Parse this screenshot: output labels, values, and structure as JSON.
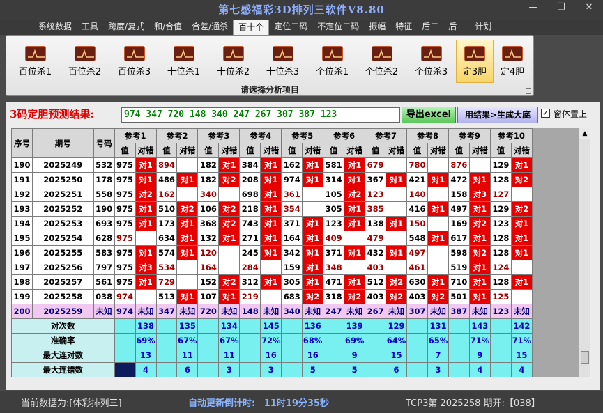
{
  "window": {
    "title": "第七感福彩3D排列三软件V8.80",
    "buttons": [
      "—",
      "❐",
      "✕"
    ]
  },
  "menu": [
    "系统数据",
    "工具",
    "跨度/复式",
    "和/合值",
    "合差/通杀",
    "百十个",
    "定位二码",
    "不定位二码",
    "振幅",
    "特征",
    "后二",
    "后一",
    "计划"
  ],
  "menu_active": "百十个",
  "ribbon": {
    "tools": [
      "百位杀1",
      "百位杀2",
      "百位杀3",
      "十位杀1",
      "十位杀2",
      "十位杀3",
      "个位杀1",
      "个位杀2",
      "个位杀3",
      "定3胆",
      "定4胆"
    ],
    "selected": "定3胆",
    "caption": "请选择分析项目"
  },
  "result": {
    "label": "3码定胆预测结果:",
    "value": "974 347 720 148 340 247 267 307 387 123",
    "excel_button": "导出excel",
    "gen_button": "用结果>生成大底",
    "topmost_checked": "✓",
    "topmost_label": "窗体置上"
  },
  "grid": {
    "headers": {
      "seq": "序号",
      "period": "期号",
      "number": "号码",
      "val": "值",
      "check": "对错"
    },
    "refs": [
      "参考1",
      "参考2",
      "参考3",
      "参考4",
      "参考5",
      "参考6",
      "参考7",
      "参考8",
      "参考9",
      "参考10"
    ],
    "rows": [
      {
        "seq": "190",
        "period": "2025249",
        "number": "532",
        "cells": [
          [
            "975",
            "对1"
          ],
          [
            "894",
            ""
          ],
          [
            "182",
            "对1"
          ],
          [
            "384",
            "对1"
          ],
          [
            "162",
            "对1"
          ],
          [
            "581",
            "对1"
          ],
          [
            "679",
            ""
          ],
          [
            "780",
            ""
          ],
          [
            "876",
            ""
          ],
          [
            "129",
            "对1"
          ]
        ]
      },
      {
        "seq": "191",
        "period": "2025250",
        "number": "178",
        "cells": [
          [
            "975",
            "对1"
          ],
          [
            "486",
            "对1"
          ],
          [
            "182",
            "对2"
          ],
          [
            "208",
            "对1"
          ],
          [
            "974",
            "对1"
          ],
          [
            "314",
            "对1"
          ],
          [
            "367",
            "对1"
          ],
          [
            "421",
            "对1"
          ],
          [
            "472",
            "对1"
          ],
          [
            "128",
            "对2"
          ]
        ]
      },
      {
        "seq": "192",
        "period": "2025251",
        "number": "558",
        "cells": [
          [
            "975",
            "对2"
          ],
          [
            "162",
            ""
          ],
          [
            "340",
            ""
          ],
          [
            "698",
            "对1"
          ],
          [
            "361",
            ""
          ],
          [
            "105",
            "对2"
          ],
          [
            "123",
            ""
          ],
          [
            "140",
            ""
          ],
          [
            "158",
            "对3"
          ],
          [
            "127",
            ""
          ]
        ]
      },
      {
        "seq": "193",
        "period": "2025252",
        "number": "190",
        "cells": [
          [
            "975",
            "对1"
          ],
          [
            "510",
            "对2"
          ],
          [
            "106",
            "对2"
          ],
          [
            "218",
            "对1"
          ],
          [
            "354",
            ""
          ],
          [
            "305",
            "对1"
          ],
          [
            "385",
            ""
          ],
          [
            "416",
            "对1"
          ],
          [
            "497",
            "对1"
          ],
          [
            "129",
            "对2"
          ]
        ]
      },
      {
        "seq": "194",
        "period": "2025253",
        "number": "693",
        "cells": [
          [
            "975",
            "对1"
          ],
          [
            "173",
            "对1"
          ],
          [
            "368",
            "对2"
          ],
          [
            "743",
            "对1"
          ],
          [
            "371",
            "对1"
          ],
          [
            "123",
            "对1"
          ],
          [
            "138",
            "对1"
          ],
          [
            "150",
            ""
          ],
          [
            "169",
            "对2"
          ],
          [
            "123",
            "对1"
          ]
        ]
      },
      {
        "seq": "195",
        "period": "2025254",
        "number": "628",
        "cells": [
          [
            "975",
            ""
          ],
          [
            "634",
            "对1"
          ],
          [
            "132",
            "对1"
          ],
          [
            "271",
            "对1"
          ],
          [
            "164",
            "对1"
          ],
          [
            "409",
            ""
          ],
          [
            "479",
            ""
          ],
          [
            "548",
            "对1"
          ],
          [
            "617",
            "对1"
          ],
          [
            "128",
            "对1"
          ]
        ]
      },
      {
        "seq": "196",
        "period": "2025255",
        "number": "583",
        "cells": [
          [
            "975",
            "对1"
          ],
          [
            "574",
            "对1"
          ],
          [
            "120",
            ""
          ],
          [
            "245",
            "对1"
          ],
          [
            "342",
            "对1"
          ],
          [
            "371",
            "对1"
          ],
          [
            "432",
            "对1"
          ],
          [
            "497",
            ""
          ],
          [
            "598",
            "对2"
          ],
          [
            "128",
            "对1"
          ]
        ]
      },
      {
        "seq": "197",
        "period": "2025256",
        "number": "797",
        "cells": [
          [
            "975",
            "对3"
          ],
          [
            "534",
            ""
          ],
          [
            "164",
            ""
          ],
          [
            "284",
            ""
          ],
          [
            "159",
            "对1"
          ],
          [
            "348",
            ""
          ],
          [
            "403",
            ""
          ],
          [
            "461",
            ""
          ],
          [
            "519",
            "对1"
          ],
          [
            "124",
            ""
          ]
        ]
      },
      {
        "seq": "198",
        "period": "2025257",
        "number": "561",
        "cells": [
          [
            "975",
            "对1"
          ],
          [
            "729",
            ""
          ],
          [
            "152",
            "对2"
          ],
          [
            "312",
            "对1"
          ],
          [
            "305",
            "对1"
          ],
          [
            "471",
            "对1"
          ],
          [
            "512",
            "对2"
          ],
          [
            "630",
            "对1"
          ],
          [
            "710",
            "对1"
          ],
          [
            "128",
            "对1"
          ]
        ]
      },
      {
        "seq": "199",
        "period": "2025258",
        "number": "038",
        "cells": [
          [
            "974",
            ""
          ],
          [
            "513",
            "对1"
          ],
          [
            "107",
            "对1"
          ],
          [
            "219",
            ""
          ],
          [
            "683",
            "对2"
          ],
          [
            "318",
            "对2"
          ],
          [
            "403",
            "对2"
          ],
          [
            "403",
            "对2"
          ],
          [
            "501",
            "对1"
          ],
          [
            "125",
            ""
          ]
        ]
      },
      {
        "seq": "200",
        "period": "2025259",
        "number": "未知",
        "cells": [
          [
            "974",
            "未知"
          ],
          [
            "347",
            "未知"
          ],
          [
            "720",
            "未知"
          ],
          [
            "148",
            "未知"
          ],
          [
            "340",
            "未知"
          ],
          [
            "247",
            "未知"
          ],
          [
            "267",
            "未知"
          ],
          [
            "307",
            "未知"
          ],
          [
            "387",
            "未知"
          ],
          [
            "123",
            "未知"
          ]
        ]
      }
    ],
    "stats": [
      {
        "label": "对次数",
        "values": [
          "138",
          "135",
          "134",
          "145",
          "136",
          "139",
          "129",
          "131",
          "143",
          "142"
        ]
      },
      {
        "label": "准确率",
        "values": [
          "69%",
          "67%",
          "67%",
          "72%",
          "68%",
          "69%",
          "64%",
          "65%",
          "71%",
          "71%"
        ]
      },
      {
        "label": "最大连对数",
        "values": [
          "13",
          "11",
          "11",
          "16",
          "16",
          "9",
          "15",
          "7",
          "9",
          "15"
        ]
      },
      {
        "label": "最大连错数",
        "values": [
          "4",
          "6",
          "3",
          "3",
          "5",
          "5",
          "6",
          "3",
          "4",
          "4"
        ]
      }
    ]
  },
  "status": {
    "current": "当前数据为:[体彩排列三]",
    "countdown_label": "自动更新倒计时:",
    "countdown_value": "11时19分35秒",
    "draw": "TCP3第 2025258 期开:【038】"
  }
}
